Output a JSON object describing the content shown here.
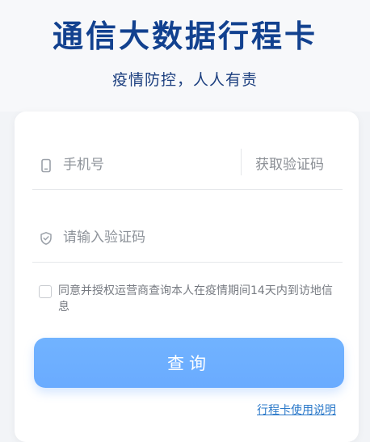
{
  "header": {
    "title": "通信大数据行程卡",
    "subtitle": "疫情防控，人人有责"
  },
  "form": {
    "phone_placeholder": "手机号",
    "get_code_label": "获取验证码",
    "code_placeholder": "请输入验证码",
    "agreement_text": "同意并授权运营商查询本人在疫情期间14天内到访地信息",
    "query_label": "查询",
    "help_link": "行程卡使用说明"
  },
  "icons": {
    "phone": "phone-icon",
    "shield": "shield-icon"
  },
  "colors": {
    "title": "#12418f",
    "button": "#6aabff",
    "link": "#2a78c9"
  }
}
